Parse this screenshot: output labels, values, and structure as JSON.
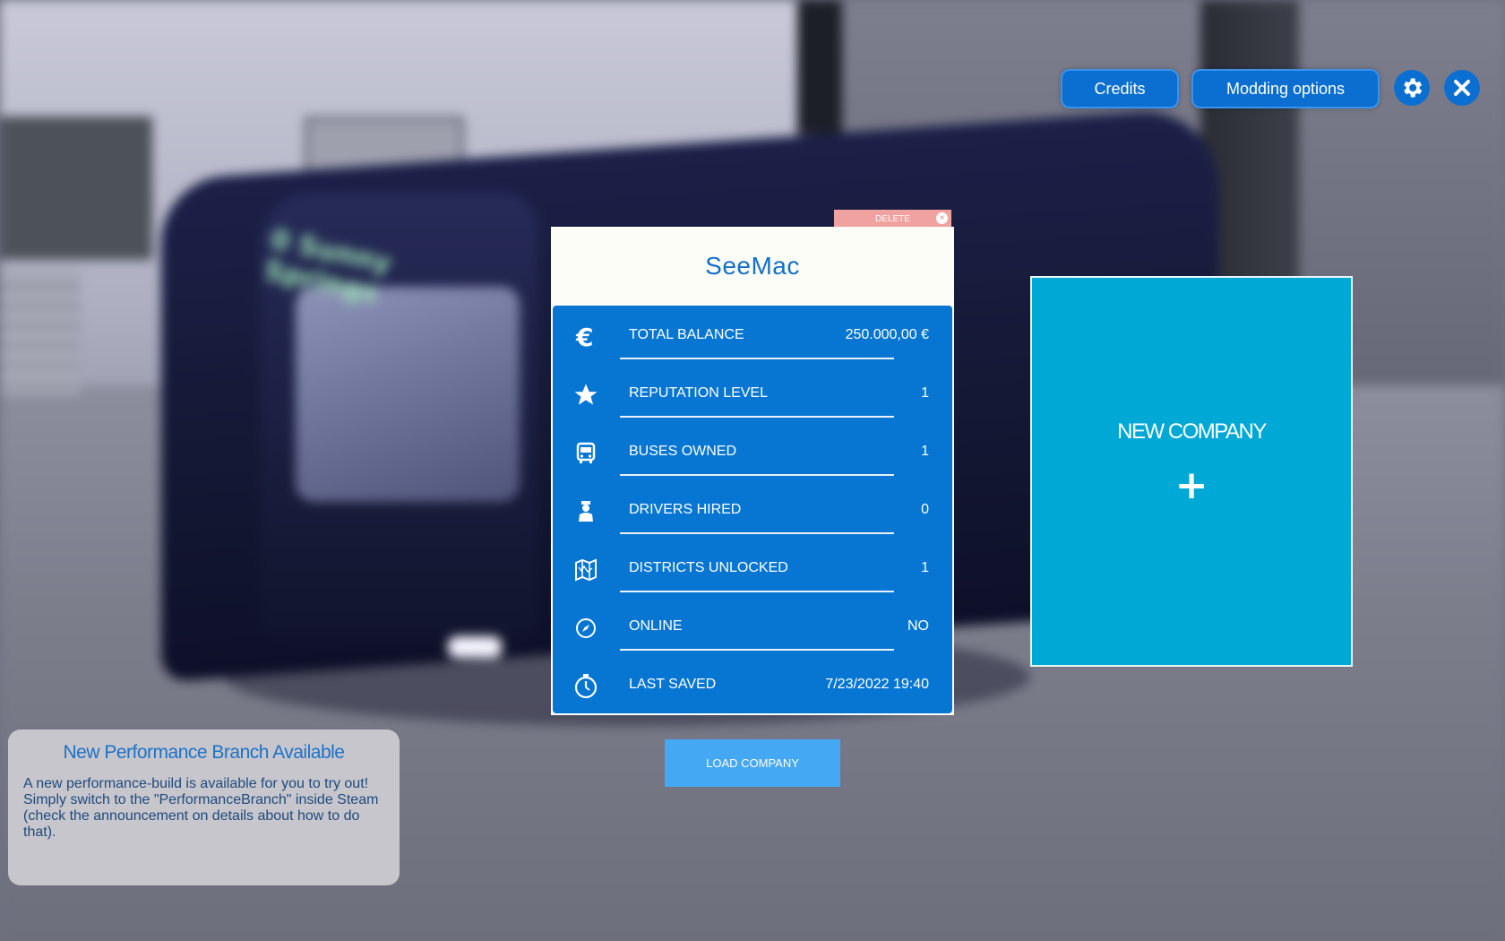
{
  "header": {
    "credits_label": "Credits",
    "modding_label": "Modding options",
    "settings_icon": "gear-icon",
    "close_icon": "close-icon"
  },
  "company": {
    "name": "SeeMac",
    "delete_label": "DELETE",
    "stats": [
      {
        "icon": "euro-icon",
        "label": "TOTAL BALANCE",
        "value": "250.000,00 €"
      },
      {
        "icon": "star-icon",
        "label": "REPUTATION LEVEL",
        "value": "1"
      },
      {
        "icon": "bus-icon",
        "label": "BUSES OWNED",
        "value": "1"
      },
      {
        "icon": "driver-icon",
        "label": "DRIVERS HIRED",
        "value": "0"
      },
      {
        "icon": "map-icon",
        "label": "DISTRICTS UNLOCKED",
        "value": "1"
      },
      {
        "icon": "compass-icon",
        "label": "ONLINE",
        "value": "NO"
      },
      {
        "icon": "stopwatch-icon",
        "label": "LAST SAVED",
        "value": "7/23/2022 19:40"
      }
    ],
    "load_label": "LOAD COMPANY"
  },
  "new_company": {
    "label": "NEW COMPANY",
    "plus": "+"
  },
  "notice": {
    "title": "New Performance Branch Available",
    "body": "A new performance-build is available for you to try out! Simply switch to the \"PerformanceBranch\" inside Steam (check the announcement on details about how to do that)."
  },
  "colors": {
    "accent": "#0776d3",
    "tile": "#00a8d6",
    "load_button": "#45a8f3",
    "delete_tab": "#f0a2a0",
    "title_text": "#1370c9"
  }
}
